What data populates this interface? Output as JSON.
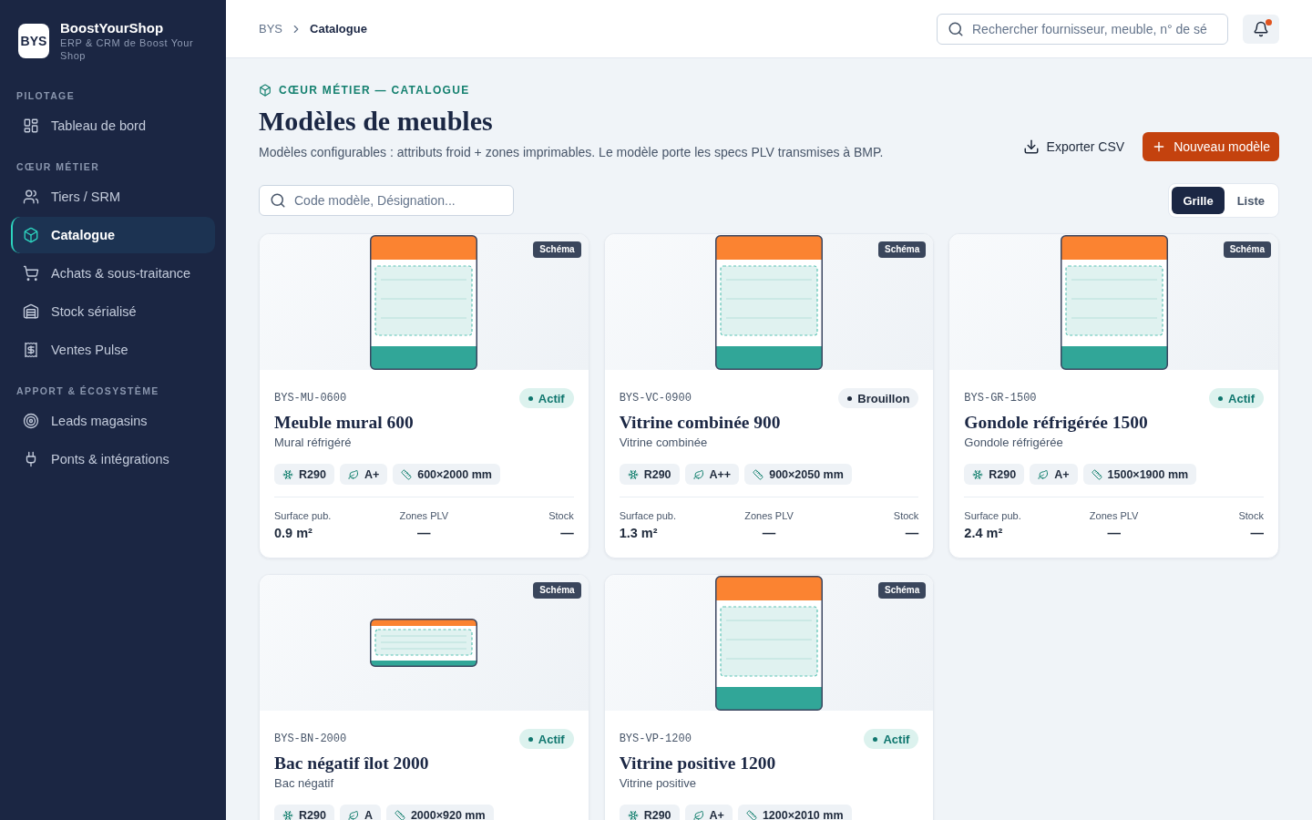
{
  "sidebar": {
    "brand": {
      "logo": "BYS",
      "name": "BoostYourShop",
      "tagline": "ERP & CRM de Boost Your Shop"
    },
    "sections": [
      {
        "title": "PILOTAGE",
        "items": [
          {
            "kind": "dashboard",
            "label": "Tableau de bord",
            "selected": false
          }
        ]
      },
      {
        "title": "CŒUR MÉTIER",
        "items": [
          {
            "kind": "partners",
            "label": "Tiers / SRM",
            "selected": false
          },
          {
            "kind": "catalogue",
            "label": "Catalogue",
            "selected": true
          },
          {
            "kind": "purchases",
            "label": "Achats & sous-traitance",
            "selected": false
          },
          {
            "kind": "stock",
            "label": "Stock sérialisé",
            "selected": false
          },
          {
            "kind": "sales",
            "label": "Ventes Pulse",
            "selected": false
          }
        ]
      },
      {
        "title": "APPORT & ÉCOSYSTÈME",
        "items": [
          {
            "kind": "leads",
            "label": "Leads magasins",
            "selected": false
          },
          {
            "kind": "integrations",
            "label": "Ponts & intégrations",
            "selected": false
          }
        ]
      }
    ]
  },
  "header": {
    "breadcrumb": [
      {
        "label": "BYS",
        "current": false
      },
      {
        "label": "Catalogue",
        "current": true
      }
    ],
    "search": {
      "placeholder": "Rechercher fournisseur, meuble, n° de sé"
    },
    "notifications": {
      "unread": true
    }
  },
  "page": {
    "eyebrow": "CŒUR MÉTIER — CATALOGUE",
    "title": "Modèles de meubles",
    "description": "Modèles configurables : attributs froid + zones imprimables. Le modèle porte les specs PLV transmises à BMP.",
    "actions": [
      {
        "kind": "export",
        "label": "Exporter CSV"
      },
      {
        "kind": "create",
        "label": "Nouveau modèle"
      }
    ],
    "filter": {
      "placeholder": "Code modèle, Désignation..."
    },
    "view_toggle": [
      {
        "label": "Grille",
        "selected": true
      },
      {
        "label": "Liste",
        "selected": false
      }
    ]
  },
  "models": [
    {
      "schema": {
        "kind": "upright",
        "badge": "Schéma"
      },
      "code": "BYS-MU-0600",
      "status": {
        "kind": "active",
        "label": "Actif"
      },
      "name": "Meuble mural 600",
      "category": "Mural réfrigéré",
      "specs": [
        {
          "kind": "refrigerant",
          "label": "R290"
        },
        {
          "kind": "energy",
          "label": "A+"
        },
        {
          "kind": "dimensions",
          "label": "600×2000 mm"
        }
      ],
      "stats": [
        {
          "label": "Surface pub.",
          "value": "0.9 m²"
        },
        {
          "label": "Zones PLV",
          "value": "—"
        },
        {
          "label": "Stock",
          "value": "—"
        }
      ]
    },
    {
      "schema": {
        "kind": "upright",
        "badge": "Schéma"
      },
      "code": "BYS-VC-0900",
      "status": {
        "kind": "draft",
        "label": "Brouillon"
      },
      "name": "Vitrine combinée 900",
      "category": "Vitrine combinée",
      "specs": [
        {
          "kind": "refrigerant",
          "label": "R290"
        },
        {
          "kind": "energy",
          "label": "A++"
        },
        {
          "kind": "dimensions",
          "label": "900×2050 mm"
        }
      ],
      "stats": [
        {
          "label": "Surface pub.",
          "value": "1.3 m²"
        },
        {
          "label": "Zones PLV",
          "value": "—"
        },
        {
          "label": "Stock",
          "value": "—"
        }
      ]
    },
    {
      "schema": {
        "kind": "upright",
        "badge": "Schéma"
      },
      "code": "BYS-GR-1500",
      "status": {
        "kind": "active",
        "label": "Actif"
      },
      "name": "Gondole réfrigérée 1500",
      "category": "Gondole réfrigérée",
      "specs": [
        {
          "kind": "refrigerant",
          "label": "R290"
        },
        {
          "kind": "energy",
          "label": "A+"
        },
        {
          "kind": "dimensions",
          "label": "1500×1900 mm"
        }
      ],
      "stats": [
        {
          "label": "Surface pub.",
          "value": "2.4 m²"
        },
        {
          "label": "Zones PLV",
          "value": "—"
        },
        {
          "label": "Stock",
          "value": "—"
        }
      ]
    },
    {
      "schema": {
        "kind": "chest",
        "badge": "Schéma"
      },
      "code": "BYS-BN-2000",
      "status": {
        "kind": "active",
        "label": "Actif"
      },
      "name": "Bac négatif îlot 2000",
      "category": "Bac négatif",
      "specs": [
        {
          "kind": "refrigerant",
          "label": "R290"
        },
        {
          "kind": "energy",
          "label": "A"
        },
        {
          "kind": "dimensions",
          "label": "2000×920 mm"
        }
      ]
    },
    {
      "schema": {
        "kind": "upright",
        "badge": "Schéma"
      },
      "code": "BYS-VP-1200",
      "status": {
        "kind": "active",
        "label": "Actif"
      },
      "name": "Vitrine positive 1200",
      "category": "Vitrine positive",
      "specs": [
        {
          "kind": "refrigerant",
          "label": "R290"
        },
        {
          "kind": "energy",
          "label": "A+"
        },
        {
          "kind": "dimensions",
          "label": "1200×2010 mm"
        }
      ]
    }
  ]
}
